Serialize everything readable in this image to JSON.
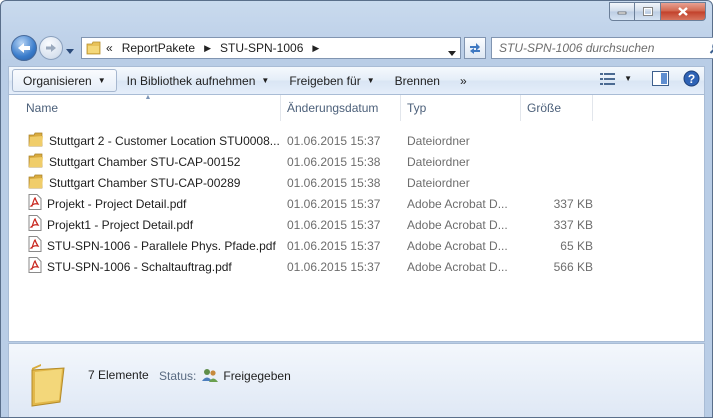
{
  "address": {
    "overflow": "«",
    "crumbs": [
      "ReportPakete",
      "STU-SPN-1006"
    ]
  },
  "search": {
    "placeholder": "STU-SPN-1006 durchsuchen"
  },
  "toolbar": {
    "organize": "Organisieren",
    "library": "In Bibliothek aufnehmen",
    "share": "Freigeben für",
    "burn": "Brennen",
    "more": "»"
  },
  "columns": {
    "name": "Name",
    "date": "Änderungsdatum",
    "type": "Typ",
    "size": "Größe"
  },
  "files": [
    {
      "name": "Stuttgart 2 - Customer Location STU0008...",
      "date": "01.06.2015 15:37",
      "type": "Dateiordner",
      "size": "",
      "icon": "folder-icon"
    },
    {
      "name": "Stuttgart Chamber STU-CAP-00152",
      "date": "01.06.2015 15:38",
      "type": "Dateiordner",
      "size": "",
      "icon": "folder-icon"
    },
    {
      "name": "Stuttgart Chamber STU-CAP-00289",
      "date": "01.06.2015 15:38",
      "type": "Dateiordner",
      "size": "",
      "icon": "folder-icon"
    },
    {
      "name": "Projekt - Project Detail.pdf",
      "date": "01.06.2015 15:37",
      "type": "Adobe Acrobat D...",
      "size": "337 KB",
      "icon": "pdf-icon"
    },
    {
      "name": "Projekt1 - Project Detail.pdf",
      "date": "01.06.2015 15:37",
      "type": "Adobe Acrobat D...",
      "size": "337 KB",
      "icon": "pdf-icon"
    },
    {
      "name": "STU-SPN-1006 - Parallele Phys. Pfade.pdf",
      "date": "01.06.2015 15:37",
      "type": "Adobe Acrobat D...",
      "size": "65 KB",
      "icon": "pdf-icon"
    },
    {
      "name": "STU-SPN-1006 - Schaltauftrag.pdf",
      "date": "01.06.2015 15:37",
      "type": "Adobe Acrobat D...",
      "size": "566 KB",
      "icon": "pdf-icon"
    }
  ],
  "details": {
    "count": "7 Elemente",
    "status_label": "Status:",
    "status_value": "Freigegeben"
  },
  "colors": {
    "accent": "#3a7ccb",
    "folder": "#e8c25a",
    "pdf": "#c8251d"
  }
}
